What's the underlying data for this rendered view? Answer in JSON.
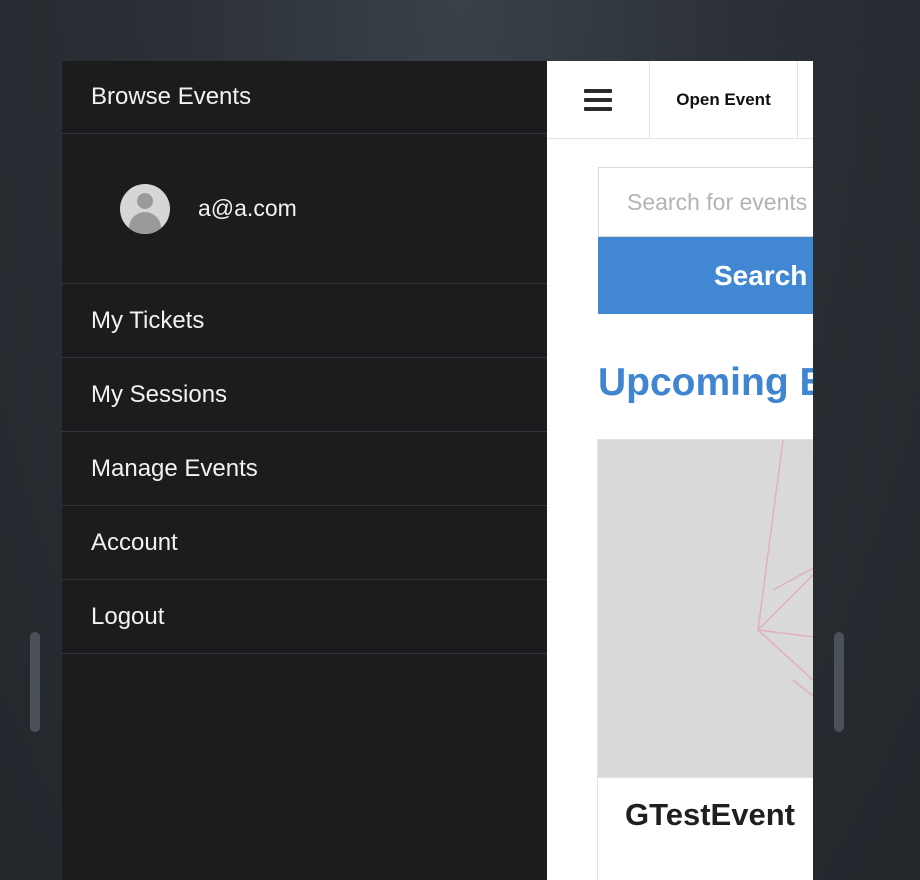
{
  "drawer": {
    "title": "Browse Events",
    "user_email": "a@a.com",
    "items": [
      {
        "label": "My Tickets"
      },
      {
        "label": "My Sessions"
      },
      {
        "label": "Manage Events"
      },
      {
        "label": "Account"
      },
      {
        "label": "Logout"
      }
    ]
  },
  "topbar": {
    "menu_icon": "hamburger-menu-icon",
    "brand": "Open Event"
  },
  "search": {
    "placeholder": "Search for events",
    "button_label": "Search"
  },
  "main": {
    "section_title": "Upcoming Events"
  },
  "events": [
    {
      "name": "GTestEvent"
    }
  ],
  "colors": {
    "drawer_bg": "#1b1c1d",
    "accent": "#4187d2",
    "heading": "#3f85d0"
  }
}
